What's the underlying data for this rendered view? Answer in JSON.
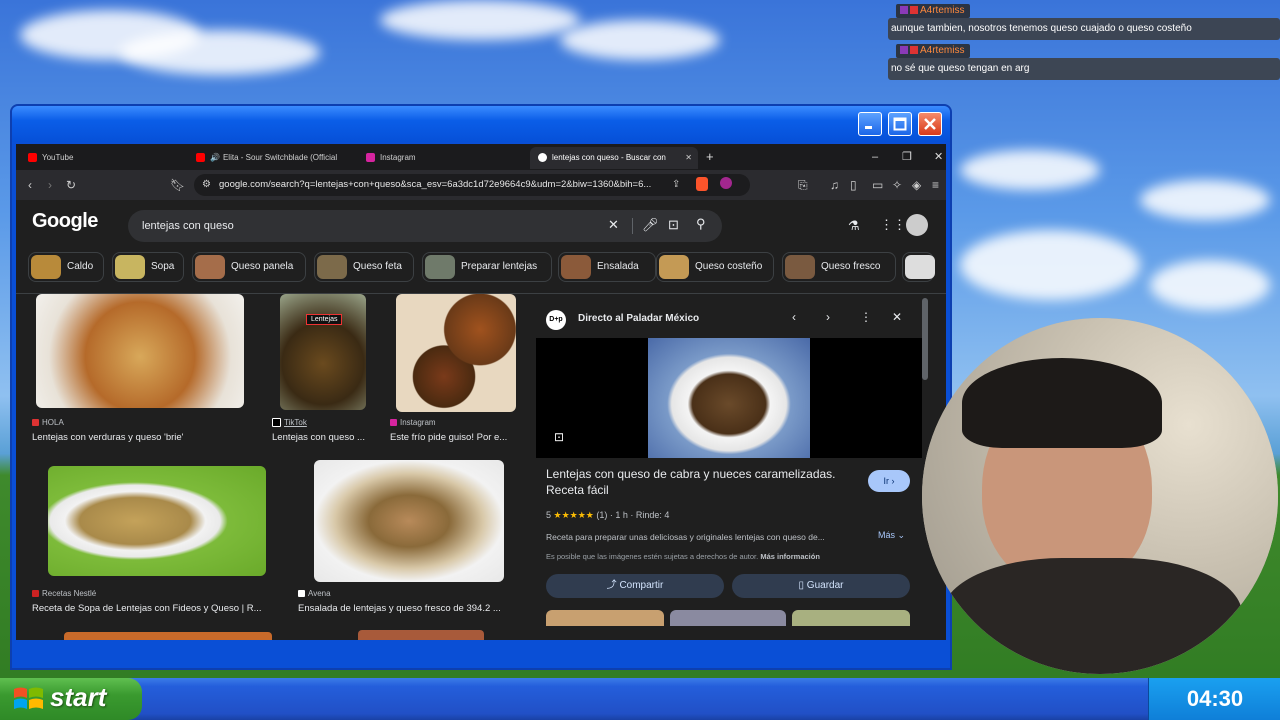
{
  "chat": [
    {
      "user": "A4rtemiss",
      "message": "aunque tambien, nosotros tenemos queso cuajado o queso costeño"
    },
    {
      "user": "A4rtemiss",
      "message": "no sé que queso tengan en arg"
    }
  ],
  "tabs": [
    {
      "label": "YouTube",
      "active": false
    },
    {
      "label": "Elita - Sour Switchblade (Official",
      "active": false
    },
    {
      "label": "Instagram",
      "active": false
    },
    {
      "label": "lentejas con queso - Buscar con",
      "active": true
    }
  ],
  "url": "google.com/search?q=lentejas+con+queso&sca_esv=6a3dc1d72e9664c9&udm=2&biw=1360&bih=6...",
  "google": {
    "logo": "Google",
    "query": "lentejas con queso"
  },
  "chips": [
    "Caldo",
    "Sopa",
    "Queso panela",
    "Queso feta",
    "Preparar lentejas",
    "Ensalada",
    "Queso costeño",
    "Queso fresco"
  ],
  "results": [
    {
      "source": "HOLA",
      "title": "Lentejas con verduras y queso 'brie'"
    },
    {
      "source": "TikTok",
      "title": "Lentejas con queso ...",
      "overlay": "Lentejas"
    },
    {
      "source": "Instagram",
      "title": "Este frío pide guiso! Por e..."
    },
    {
      "source": "Recetas Nestlé",
      "title": "Receta de Sopa de Lentejas con Fideos y Queso | R..."
    },
    {
      "source": "Avena",
      "title": "Ensalada de lentejas y queso fresco de 394.2 ..."
    }
  ],
  "panel": {
    "logo": "D+p",
    "source": "Directo al Paladar México",
    "title": "Lentejas con queso de cabra y nueces caramelizadas. Receta fácil",
    "go": "Ir",
    "rating_value": "5",
    "stars": "★★★★★",
    "rating_count": "(1)",
    "time": "1 h",
    "yield": "Rinde: 4",
    "description": "Receta para preparar unas deliciosas y originales lentejas con queso de...",
    "more": "Más",
    "copyright": "Es posible que las imágenes estén sujetas a derechos de autor.",
    "more_info": "Más información",
    "share": "Compartir",
    "save": "Guardar"
  },
  "taskbar": {
    "start": "start",
    "clock": "04:30"
  },
  "colors": {
    "accent": "#a8c7fa",
    "brand_orange": "#ff8a3d"
  }
}
